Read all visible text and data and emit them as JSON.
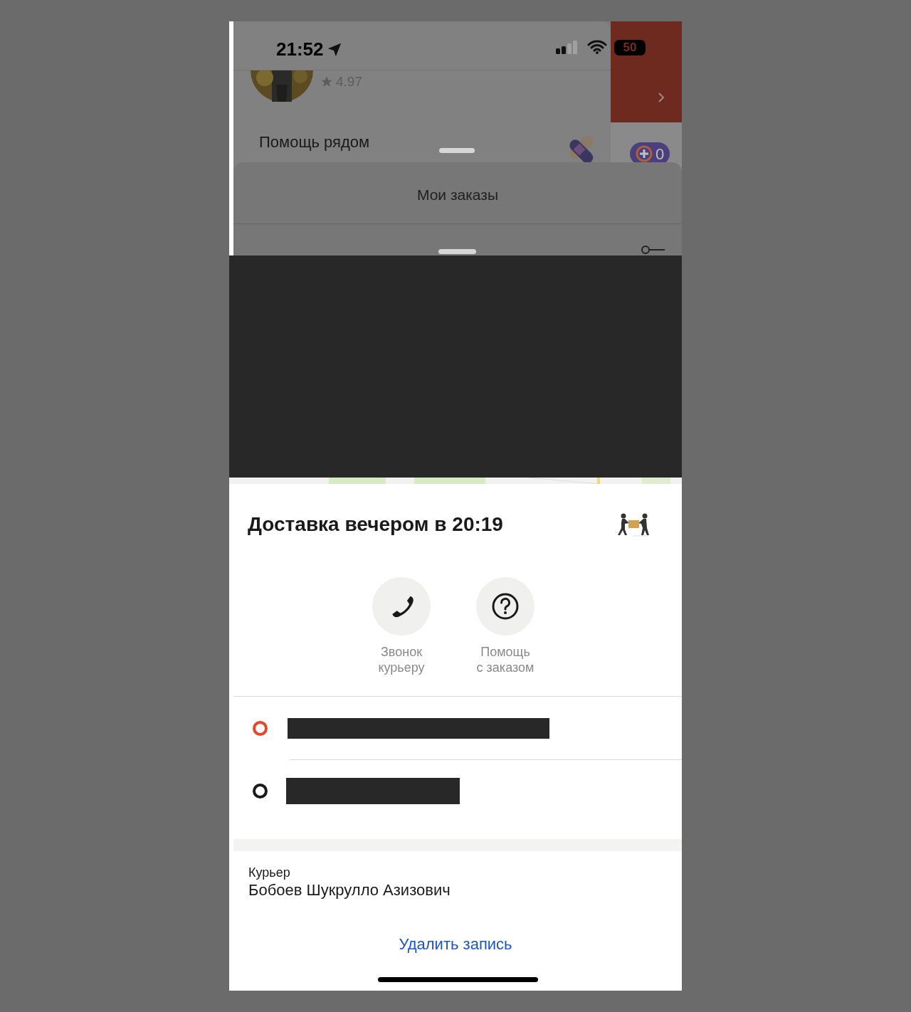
{
  "status_bar": {
    "time": "21:52",
    "battery": "50"
  },
  "background_card": {
    "rating": "4.97",
    "title": "Помощь рядом",
    "badge_count": "0"
  },
  "orders_sheet": {
    "title": "Мои заказы"
  },
  "order": {
    "title": "Доставка вечером в 20:19",
    "actions": [
      {
        "kind": "call",
        "label": "Звонок\nкурьеру"
      },
      {
        "kind": "help",
        "label": "Помощь\nс заказом"
      }
    ],
    "route_points": [
      {
        "color": "#e8452c"
      },
      {
        "color": "#1a1a1a"
      }
    ],
    "courier_label": "Курьер",
    "courier_name": "Бобоев Шукрулло Азизович",
    "delete_link": "Удалить запись"
  }
}
